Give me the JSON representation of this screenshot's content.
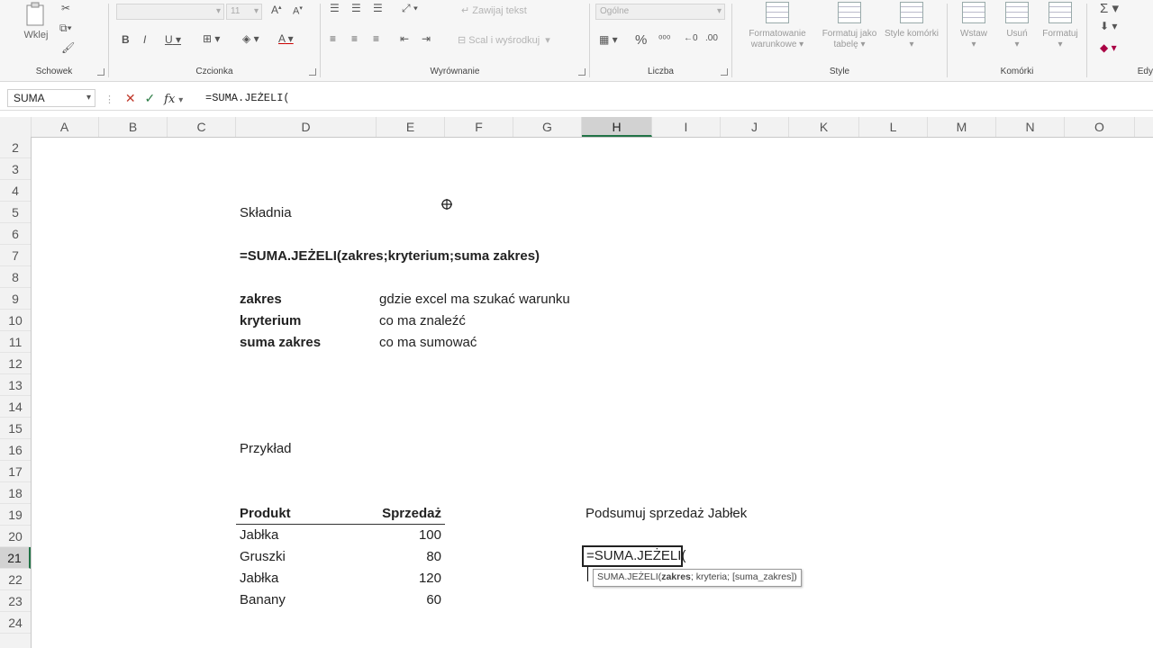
{
  "ribbon": {
    "clipboard": {
      "paste_label": "Wklej",
      "group_label": "Schowek"
    },
    "font": {
      "font_name": "",
      "font_size": "11",
      "bold": "B",
      "italic": "I",
      "underline": "U",
      "grow": "A",
      "shrink": "A",
      "color_a": "A",
      "group_label": "Czcionka"
    },
    "alignment": {
      "wrap_text": "Zawijaj tekst",
      "merge_center": "Scal i wyśrodkuj",
      "group_label": "Wyrównanie"
    },
    "number": {
      "format": "Ogólne",
      "percent": "%",
      "group_label": "Liczba"
    },
    "styles": {
      "conditional": "Formatowanie warunkowe",
      "as_table": "Formatuj jako tabelę",
      "cell_styles": "Style komórki",
      "group_label": "Style"
    },
    "cells": {
      "insert": "Wstaw",
      "delete": "Usuń",
      "format": "Formatuj",
      "group_label": "Komórki"
    },
    "editing": {
      "sum": "Σ",
      "group_label": "Edy"
    }
  },
  "formula_bar": {
    "name_box": "SUMA",
    "fx": "fx",
    "formula": "=SUMA.JEŻELI("
  },
  "columns": [
    "A",
    "B",
    "C",
    "D",
    "E",
    "F",
    "G",
    "H",
    "I",
    "J",
    "K",
    "L",
    "M",
    "N",
    "O"
  ],
  "selected_column": "H",
  "rows": [
    "2",
    "3",
    "4",
    "5",
    "6",
    "7",
    "8",
    "9",
    "10",
    "11",
    "12",
    "13",
    "14",
    "15",
    "16",
    "17",
    "18",
    "19",
    "20",
    "21",
    "22",
    "23",
    "24"
  ],
  "selected_row": "21",
  "sheet": {
    "syntax_title": "Składnia",
    "syntax_formula": "=SUMA.JEŻELI(zakres;kryterium;suma zakres)",
    "args": [
      {
        "name": "zakres",
        "desc": "gdzie excel ma szukać warunku"
      },
      {
        "name": "kryterium",
        "desc": "co ma znaleźć"
      },
      {
        "name": "suma zakres",
        "desc": "co ma sumować"
      }
    ],
    "example_title": "Przykład",
    "table_headers": {
      "product": "Produkt",
      "sales": "Sprzedaż"
    },
    "table_rows": [
      {
        "product": "Jabłka",
        "sales": "100"
      },
      {
        "product": "Gruszki",
        "sales": "80"
      },
      {
        "product": "Jabłka",
        "sales": "120"
      },
      {
        "product": "Banany",
        "sales": "60"
      }
    ],
    "task": "Podsumuj sprzedaż Jabłek",
    "editing_cell": "=SUMA.JEŻELI(",
    "tooltip": {
      "fn": "SUMA.JEŻELI(",
      "arg1": "zakres",
      "rest": "; kryteria; [suma_zakres])"
    }
  }
}
